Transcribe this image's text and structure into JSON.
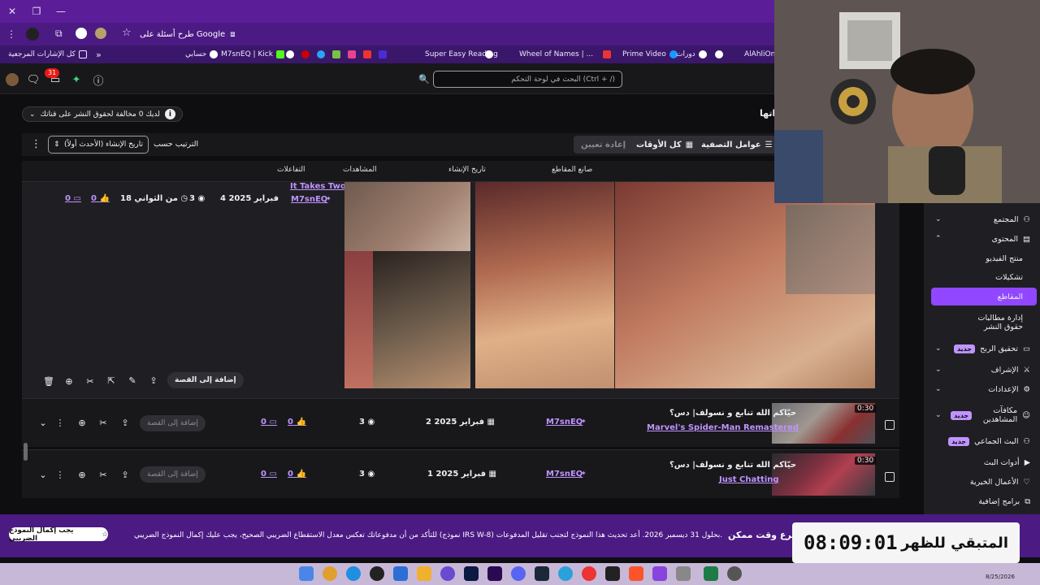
{
  "browser": {
    "omnibox_prompt": "طرح أسئلة على Google",
    "bookmarks": [
      "كل الإشارات المرجعية",
      "حسابي",
      "M7snEQ | Kick",
      "Super Easy Reading",
      "Wheel of Names | ...",
      "Prime Video",
      "دورات",
      "AlAhliOn"
    ]
  },
  "header": {
    "search_placeholder": "البحث في لوحة التحكم (Ctrl + /)",
    "notification_count": "31"
  },
  "main": {
    "title_fragment": "اتها",
    "warning_text": "لديك 0 مخالفة لحقوق النشر على قناتك",
    "filter_button": "عوامل التصفية",
    "time_button": "كل الأوقات",
    "reset_button": "إعادة تعيين",
    "sort_label": "الترتيب حسب",
    "sort_value": "تاريخ الإنشاء (الأحدث أولاً)",
    "columns": [
      "صانع المقاطع",
      "تاريخ الإنشاء",
      "المشاهدات",
      "التفاعلات"
    ],
    "expanded_clip": {
      "game": "It Takes Two",
      "creator": "M7snEQ",
      "date": "4 فبراير 2025",
      "views": "3",
      "duration": "18 من الثواني",
      "likes": "0",
      "comments": "0",
      "add_to_story": "إضافة إلى القصة"
    },
    "clips": [
      {
        "duration": "0:30",
        "title": "حيّاكم الله تنابع و نسولف| دس؟",
        "game": "Marvel's Spider-Man Remastered",
        "creator": "M7snEQ",
        "date": "2 فبراير 2025",
        "views": "3",
        "likes": "0",
        "comments": "0",
        "add_to_story": "إضافة إلى القصة"
      },
      {
        "duration": "0:30",
        "title": "حيّاكم الله تنابع و نسولف| دس؟",
        "game": "Just Chatting",
        "creator": "M7snEQ",
        "date": "1 فبراير 2025",
        "views": "3",
        "likes": "0",
        "comments": "0",
        "add_to_story": "إضافة إلى القصة"
      }
    ]
  },
  "sidebar": {
    "items": [
      {
        "label": "المجتمع"
      },
      {
        "label": "المحتوى"
      },
      {
        "label": "منتج الفيديو"
      },
      {
        "label": "تشكيلات"
      },
      {
        "label": "المقاطع"
      },
      {
        "label": "إدارة مطالبات حقوق النشر"
      },
      {
        "label": "تحقيق الربح"
      },
      {
        "label": "الإشراف"
      },
      {
        "label": "الإعدادات"
      },
      {
        "label": "مكافآت المشاهدين"
      },
      {
        "label": "البث الجماعي"
      },
      {
        "label": "أدوات البث"
      },
      {
        "label": "الأعمال الخيرية"
      },
      {
        "label": "برامج إضافية"
      }
    ],
    "new_badge": "جديد"
  },
  "banner": {
    "button_label": "يجب إكمال النموذج الضريبي",
    "text": "للتأكد من أن مدفوعاتك تعكس معدل الاستقطاع الضريبي الصحيح، يجب عليك إكمال النموذج الضريبي (نموذج IRS W-8) بحلول 31 ديسمبر 2026. أعد تحديث هذا النموذج لتجنب تقليل المدفوعات.",
    "bold_text": "أسرع وقت ممكن"
  },
  "timer": {
    "label": "المتبقي للظهر",
    "value": "08:09:01"
  },
  "taskbar": {
    "date": "8/25/2026"
  },
  "colors": {
    "accent": "#9147ff",
    "link": "#bf94ff",
    "banner": "#4b1a83"
  }
}
